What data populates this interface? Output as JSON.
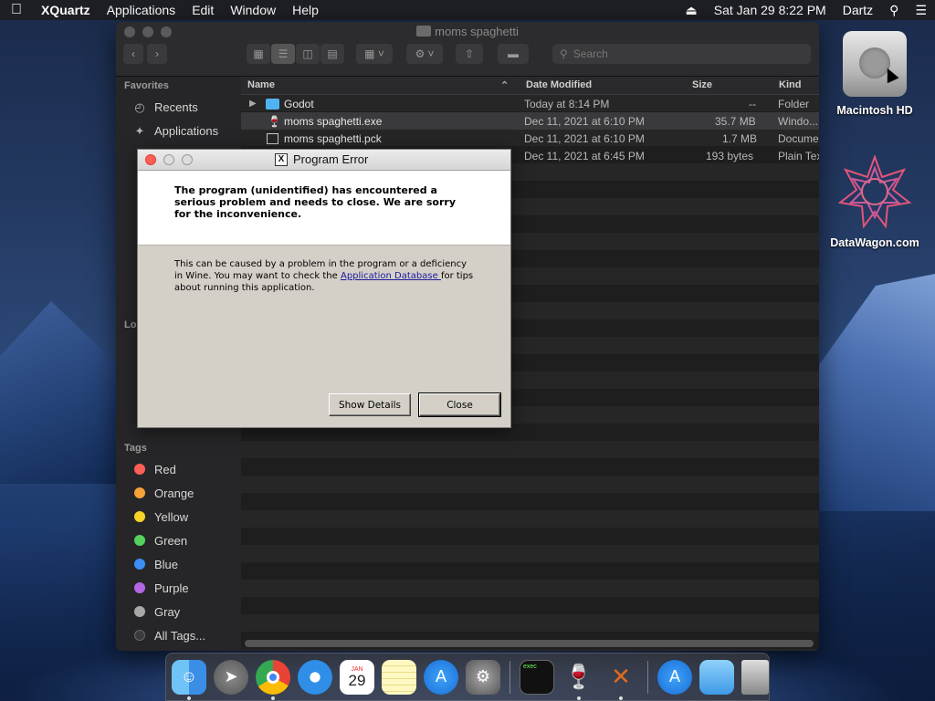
{
  "menubar": {
    "app_name": "XQuartz",
    "items": [
      "Applications",
      "Edit",
      "Window",
      "Help"
    ],
    "clock": "Sat Jan 29  8:22 PM",
    "user": "Dartz"
  },
  "finder": {
    "title": "moms spaghetti",
    "search_placeholder": "Search",
    "sidebar": {
      "favorites_header": "Favorites",
      "favorites": [
        {
          "label": "Recents",
          "icon": "clock-icon"
        },
        {
          "label": "Applications",
          "icon": "applications-icon"
        }
      ],
      "locations_header": "Lo",
      "tags_header": "Tags",
      "tags": [
        {
          "label": "Red",
          "color": "#ff5f57"
        },
        {
          "label": "Orange",
          "color": "#f6a13a"
        },
        {
          "label": "Yellow",
          "color": "#f5d327"
        },
        {
          "label": "Green",
          "color": "#53d15c"
        },
        {
          "label": "Blue",
          "color": "#3b8ff5"
        },
        {
          "label": "Purple",
          "color": "#b566e5"
        },
        {
          "label": "Gray",
          "color": "#a8a8a8"
        },
        {
          "label": "All Tags...",
          "color": "#3a3a3c"
        }
      ]
    },
    "columns": {
      "name": "Name",
      "date": "Date Modified",
      "size": "Size",
      "kind": "Kind"
    },
    "rows": [
      {
        "name": "Godot",
        "date": "Today at 8:14 PM",
        "size": "--",
        "kind": "Folder"
      },
      {
        "name": "moms spaghetti.exe",
        "date": "Dec 11, 2021 at 6:10 PM",
        "size": "35.7 MB",
        "kind": "Windo..."
      },
      {
        "name": "moms spaghetti.pck",
        "date": "Dec 11, 2021 at 6:10 PM",
        "size": "1.7 MB",
        "kind": "Docume"
      },
      {
        "name": "",
        "date": "Dec 11, 2021 at 6:45 PM",
        "size": "193 bytes",
        "kind": "Plain Tex"
      }
    ]
  },
  "dialog": {
    "title": "Program Error",
    "headline": "The program (unidentified) has encountered a serious problem and needs to close. We are sorry for the inconvenience.",
    "body_prefix": "This can be caused by a problem in the program or a deficiency in Wine. You may want to check the ",
    "link": "Application Database ",
    "body_suffix": " for tips about running this application.",
    "show_details": "Show Details",
    "close": "Close"
  },
  "desktop": {
    "hd_label": "Macintosh HD",
    "datawagon_label": "DataWagon.com"
  },
  "dock": {
    "calendar_month": "JAN",
    "calendar_day": "29",
    "terminal_text": "exec"
  }
}
